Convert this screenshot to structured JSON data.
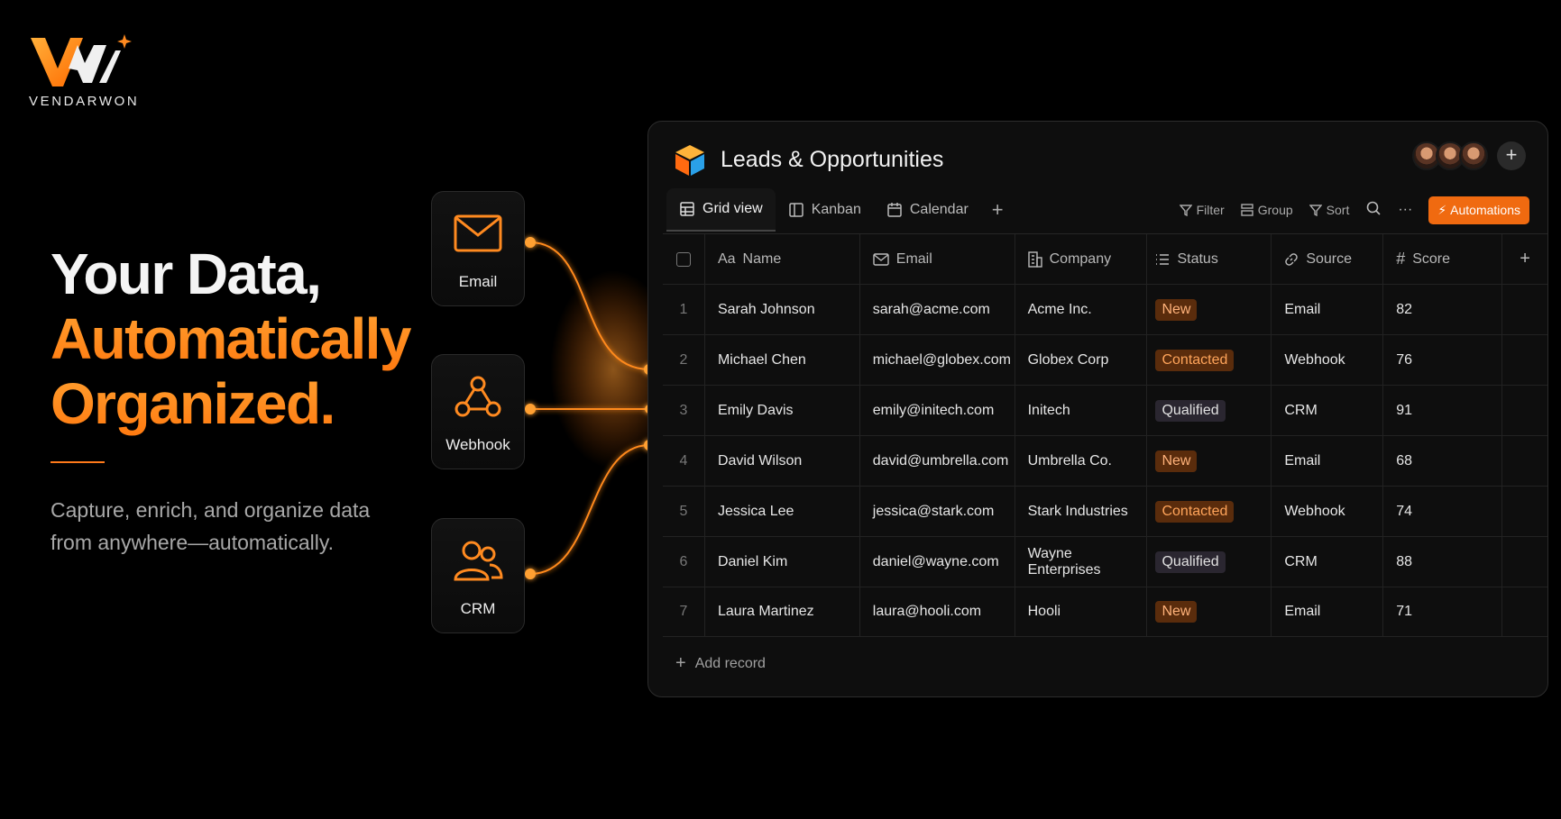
{
  "brand": {
    "name": "VENDARWON"
  },
  "hero": {
    "line1": "Your Data,",
    "line2": "Automatically",
    "line3": "Organized.",
    "tagline": "Capture, enrich, and organize data from anywhere—automatically."
  },
  "sources": [
    {
      "label": "Email",
      "icon": "envelope-icon"
    },
    {
      "label": "Webhook",
      "icon": "webhook-icon"
    },
    {
      "label": "CRM",
      "icon": "users-icon"
    }
  ],
  "app": {
    "title": "Leads & Opportunities",
    "add_collaborator": "+",
    "tabs": [
      {
        "label": "Grid view",
        "icon": "grid-icon",
        "active": true
      },
      {
        "label": "Kanban",
        "icon": "kanban-icon",
        "active": false
      },
      {
        "label": "Calendar",
        "icon": "calendar-icon",
        "active": false
      }
    ],
    "tab_add": "+",
    "tools": {
      "filter": "Filter",
      "group": "Group",
      "sort": "Sort",
      "more": "···",
      "automations": "Automations"
    },
    "columns": [
      {
        "label": "Name",
        "icon_text": "Aa"
      },
      {
        "label": "Email",
        "icon": "envelope-icon"
      },
      {
        "label": "Company",
        "icon": "building-icon"
      },
      {
        "label": "Status",
        "icon": "list-icon"
      },
      {
        "label": "Source",
        "icon": "link-icon"
      },
      {
        "label": "Score",
        "icon_text": "#"
      }
    ],
    "add_column": "+",
    "rows": [
      {
        "n": "1",
        "name": "Sarah Johnson",
        "email": "sarah@acme.com",
        "company": "Acme Inc.",
        "status": "New",
        "source": "Email",
        "score": "82"
      },
      {
        "n": "2",
        "name": "Michael Chen",
        "email": "michael@globex.com",
        "company": "Globex Corp",
        "status": "Contacted",
        "source": "Webhook",
        "score": "76"
      },
      {
        "n": "3",
        "name": "Emily Davis",
        "email": "emily@initech.com",
        "company": "Initech",
        "status": "Qualified",
        "source": "CRM",
        "score": "91"
      },
      {
        "n": "4",
        "name": "David Wilson",
        "email": "david@umbrella.com",
        "company": "Umbrella Co.",
        "status": "New",
        "source": "Email",
        "score": "68"
      },
      {
        "n": "5",
        "name": "Jessica Lee",
        "email": "jessica@stark.com",
        "company": "Stark Industries",
        "status": "Contacted",
        "source": "Webhook",
        "score": "74"
      },
      {
        "n": "6",
        "name": "Daniel Kim",
        "email": "daniel@wayne.com",
        "company": "Wayne Enterprises",
        "status": "Qualified",
        "source": "CRM",
        "score": "88"
      },
      {
        "n": "7",
        "name": "Laura Martinez",
        "email": "laura@hooli.com",
        "company": "Hooli",
        "status": "New",
        "source": "Email",
        "score": "71"
      }
    ],
    "add_record": "Add record"
  },
  "colors": {
    "accent": "#ff7a10",
    "background": "#000000",
    "panel": "#0e0e0e"
  }
}
